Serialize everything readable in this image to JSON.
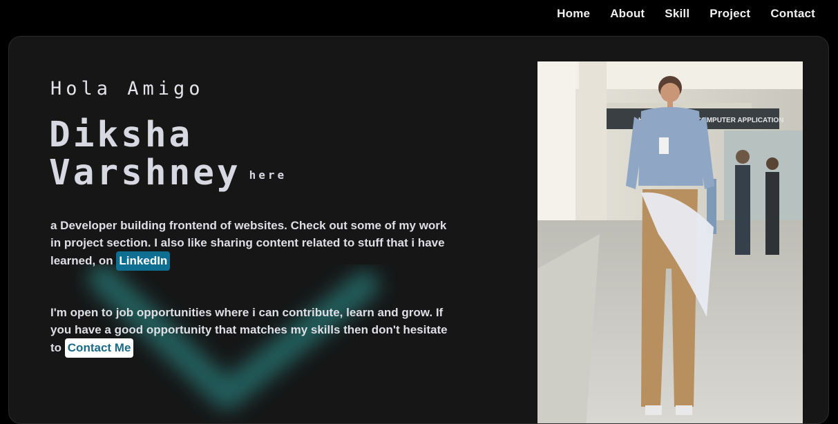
{
  "nav": {
    "items": [
      "Home",
      "About",
      "Skill",
      "Project",
      "Contact"
    ]
  },
  "hero": {
    "greeting": "Hola Amigo",
    "first_name": "Diksha",
    "last_name": "Varshney",
    "suffix": "here",
    "para1_text": "a Developer building frontend of websites. Check out some of my work in project section. I also like sharing content related to stuff that i have learned, on ",
    "linkedin_label": "LinkedIn",
    "para2_text": "I'm open to job opportunities where i can contribute, learn and grow. If you have a good opportunity that matches my skills then don't hesitate to ",
    "contact_label": "Contact Me",
    "sign_text": "KIIT SCHOOL OF COMPUTER APPLICATION"
  },
  "colors": {
    "background": "#000000",
    "card": "#161616",
    "accent_blue": "#0f6f93",
    "glow": "#2a8f8c"
  }
}
